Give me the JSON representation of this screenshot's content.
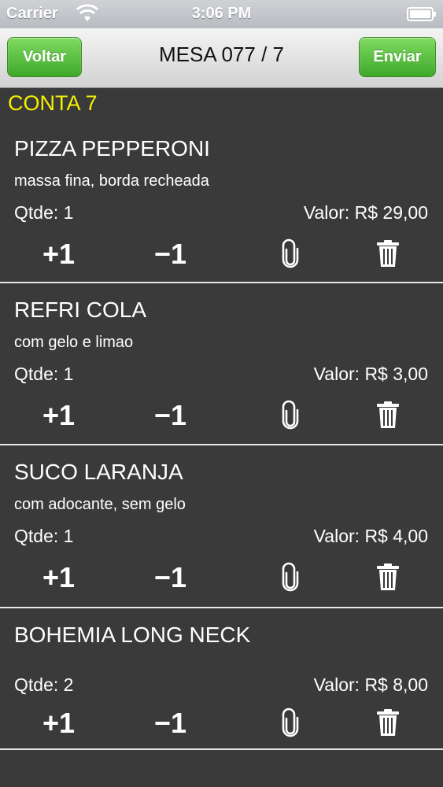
{
  "status_bar": {
    "carrier": "Carrier",
    "time": "3:06 PM"
  },
  "nav": {
    "back_label": "Voltar",
    "title": "MESA 077 / 7",
    "send_label": "Enviar"
  },
  "colors": {
    "accent": "#f6f000",
    "button_green": "#4cb834",
    "background": "#3a3a3a"
  },
  "conta_label": "CONTA 7",
  "controls": {
    "plus_label": "+1",
    "minus_label": "−1",
    "attach_icon": "paperclip-icon",
    "delete_icon": "trash-icon"
  },
  "items": [
    {
      "name": "PIZZA PEPPERONI",
      "note": "massa fina, borda recheada",
      "qty": "Qtde: 1",
      "price": "Valor: R$ 29,00"
    },
    {
      "name": "REFRI COLA",
      "note": "com gelo e limao",
      "qty": "Qtde: 1",
      "price": "Valor: R$ 3,00"
    },
    {
      "name": "SUCO LARANJA",
      "note": "com adocante, sem gelo",
      "qty": "Qtde: 1",
      "price": "Valor: R$ 4,00"
    },
    {
      "name": "BOHEMIA LONG NECK",
      "note": "",
      "qty": "Qtde: 2",
      "price": "Valor: R$ 8,00"
    }
  ]
}
